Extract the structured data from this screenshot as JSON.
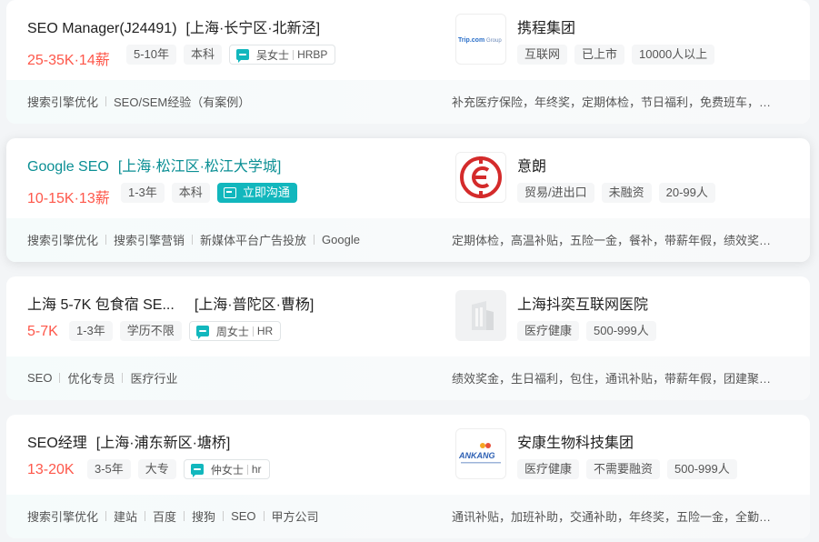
{
  "jobs": [
    {
      "title": "SEO Manager(J24491)",
      "location": "[上海·长宁区·北新泾]",
      "salary": "25-35K·14薪",
      "tags": [
        "5-10年",
        "本科"
      ],
      "recruiter": {
        "name": "吴女士",
        "role": "HRBP"
      },
      "skills": [
        "搜索引擎优化",
        "SEO/SEM经验（有案例）"
      ],
      "company": {
        "name": "携程集团",
        "tags": [
          "互联网",
          "已上市",
          "10000人以上"
        ],
        "logo_text": "Trip.com Group"
      },
      "benefits": "补充医疗保险，年终奖，定期体检，节日福利，免费班车，…"
    },
    {
      "title": "Google SEO",
      "location": "[上海·松江区·松江大学城]",
      "salary": "10-15K·13薪",
      "tags": [
        "1-3年",
        "本科"
      ],
      "cta": "立即沟通",
      "skills": [
        "搜索引擎优化",
        "搜索引擎营销",
        "新媒体平台广告投放",
        "Google"
      ],
      "company": {
        "name": "意朗",
        "tags": [
          "贸易/进出口",
          "未融资",
          "20-99人"
        ]
      },
      "benefits": "定期体检，高温补贴，五险一金，餐补，带薪年假，绩效奖…"
    },
    {
      "title": "上海 5-7K 包食宿 SE...",
      "location": "[上海·普陀区·曹杨]",
      "salary": "5-7K",
      "tags": [
        "1-3年",
        "学历不限"
      ],
      "recruiter": {
        "name": "周女士",
        "role": "HR"
      },
      "skills": [
        "SEO",
        "优化专员",
        "医疗行业"
      ],
      "company": {
        "name": "上海抖奕互联网医院",
        "tags": [
          "医疗健康",
          "500-999人"
        ]
      },
      "benefits": "绩效奖金，生日福利，包住，通讯补贴，带薪年假，团建聚…"
    },
    {
      "title": "SEO经理",
      "location": "[上海·浦东新区·塘桥]",
      "salary": "13-20K",
      "tags": [
        "3-5年",
        "大专"
      ],
      "recruiter": {
        "name": "仲女士",
        "role": "hr"
      },
      "skills": [
        "搜索引擎优化",
        "建站",
        "百度",
        "搜狗",
        "SEO",
        "甲方公司"
      ],
      "company": {
        "name": "安康生物科技集团",
        "tags": [
          "医疗健康",
          "不需要融资",
          "500-999人"
        ],
        "logo_text": "ANKANG"
      },
      "benefits": "通讯补贴，加班补助，交通补助，年终奖，五险一金，全勤…"
    }
  ],
  "colors": {
    "accent": "#12b7bd",
    "salary": "#fe574a",
    "highlight_title": "#0b8f94"
  }
}
